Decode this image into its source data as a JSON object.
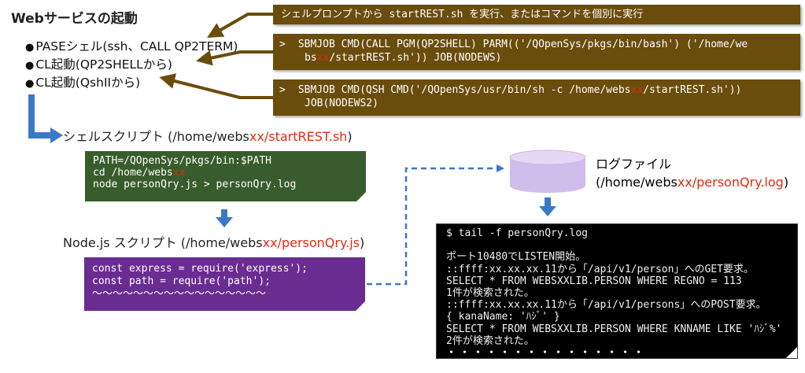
{
  "title": "Webサービスの起動",
  "bullets": [
    "PASEシェル(ssh、CALL QP2TERM)",
    "CL起動(QP2SHELLから)",
    "CL起動(QshIIから)"
  ],
  "notes": {
    "n1": "シェルプロンプトから startREST.sh を実行、またはコマンドを個別に実行",
    "n2_line1": "SBMJOB CMD(CALL PGM(QP2SHELL) PARM(('/QOpenSys/pkgs/bin/bash') ('/home/we",
    "n2_line2_a": "bs",
    "n2_line2_red": "xx",
    "n2_line2_b": "/startREST.sh')) JOB(NODEWS)",
    "n3_line1_a": "SBMJOB CMD(QSH CMD('/QOpenSys/usr/bin/sh -c /home/webs",
    "n3_line1_red": "xx",
    "n3_line1_b": "/startREST.sh'))",
    "n3_line2": "JOB(NODEWS2)",
    "prompt_symbol": ">"
  },
  "shell_script": {
    "label": "シェルスクリプト (/home/webs",
    "red": "xx",
    "file": "/startREST.sh",
    "close": ")",
    "lines": [
      "PATH=/QOpenSys/pkgs/bin:$PATH",
      "cd /home/webs",
      "node personQry.js > personQry.log"
    ],
    "line2_red": "xx"
  },
  "node_script": {
    "label": "Node.js スクリプト (/home/webs",
    "red": "xx",
    "file": "/personQry.js",
    "close": ")",
    "lines": [
      "const express = require('express');",
      "const path = require('path');",
      "～～～～～～～～～～～～～～～～～"
    ]
  },
  "log_file": {
    "label": "ログファイル",
    "path_a": "(/home/webs",
    "red": "xx",
    "path_b": "/personQry.log",
    "close": ")"
  },
  "console": {
    "command": "$ tail -f personQry.log",
    "lines": [
      "ポート10480でLISTEN開始。",
      "::ffff:xx.xx.xx.11から「/api/v1/person」へのGET要求。",
      "SELECT * FROM WEBSXXLIB.PERSON WHERE REGNO = 113",
      "1件が検索された。",
      "::ffff:xx.xx.xx.11から「/api/v1/persons」へのPOST要求。",
      "{ kanaName: 'ﾊｼﾞ' }",
      "SELECT * FROM WEBSXXLIB.PERSON WHERE KNNAME LIKE 'ﾊｼﾞ%'",
      "2件が検索された。",
      "・・・・・・・・・・・・・・・"
    ]
  },
  "colors": {
    "banner": "#6a4c0c",
    "shell_box": "#385c2b",
    "node_box": "#6a2c91",
    "console": "#000000",
    "flow_arrow": "#3c78c8",
    "accent_red": "#e12b12",
    "cylinder_top": "#e6d8f4",
    "cylinder_body": "#d1bdeb"
  }
}
